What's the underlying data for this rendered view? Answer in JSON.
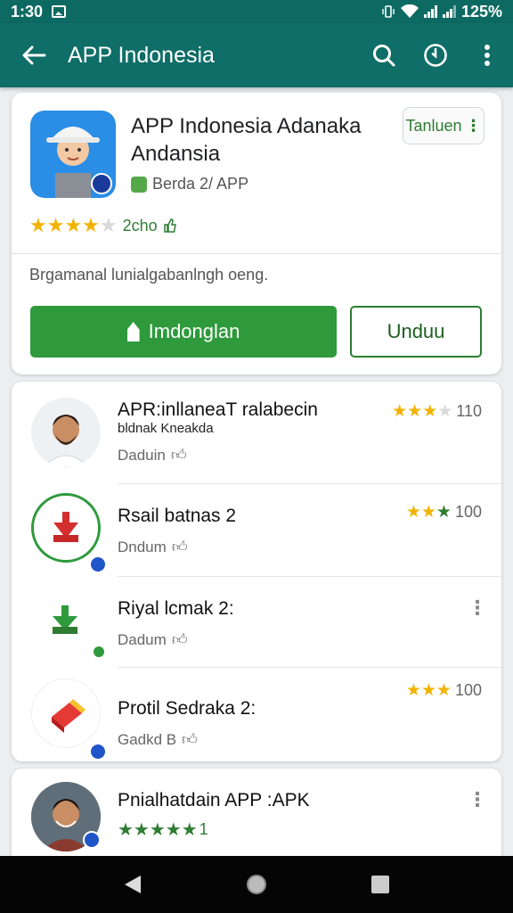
{
  "status_bar": {
    "time": "1:30",
    "battery": "125%"
  },
  "app_bar": {
    "title": "APP Indonesia"
  },
  "featured": {
    "title": "APP Indonesia Adanaka Andansia",
    "developer": "Berda 2/ APP",
    "rating_stars": 4,
    "rating_text": "2cho",
    "top_button": "Tanluen",
    "description": "Brgamanal lunialgabanlngh oeng.",
    "install_label": "Imdonglan",
    "open_label": "Unduu"
  },
  "list": [
    {
      "name": "APR:inllaneaT ralabecin",
      "subtitle": "bldnak Kneakda",
      "downloads": "Daduin",
      "stars": 3,
      "score": "110"
    },
    {
      "name": "Rsail batnas 2",
      "downloads": "Dndum",
      "stars": 3,
      "score": "100"
    },
    {
      "name": "Riyal lcmak 2:",
      "downloads": "Dadum"
    },
    {
      "name": "Protil Sedraka 2:",
      "downloads": "Gadkd B",
      "stars": 3,
      "score": "100"
    }
  ],
  "bottom_item": {
    "name": "Pnialhatdain APP :APK",
    "stars": 5,
    "score": "1"
  },
  "colors": {
    "appbar": "#0f6e67",
    "accent_green": "#2f9a3c",
    "star": "#f2b300"
  }
}
